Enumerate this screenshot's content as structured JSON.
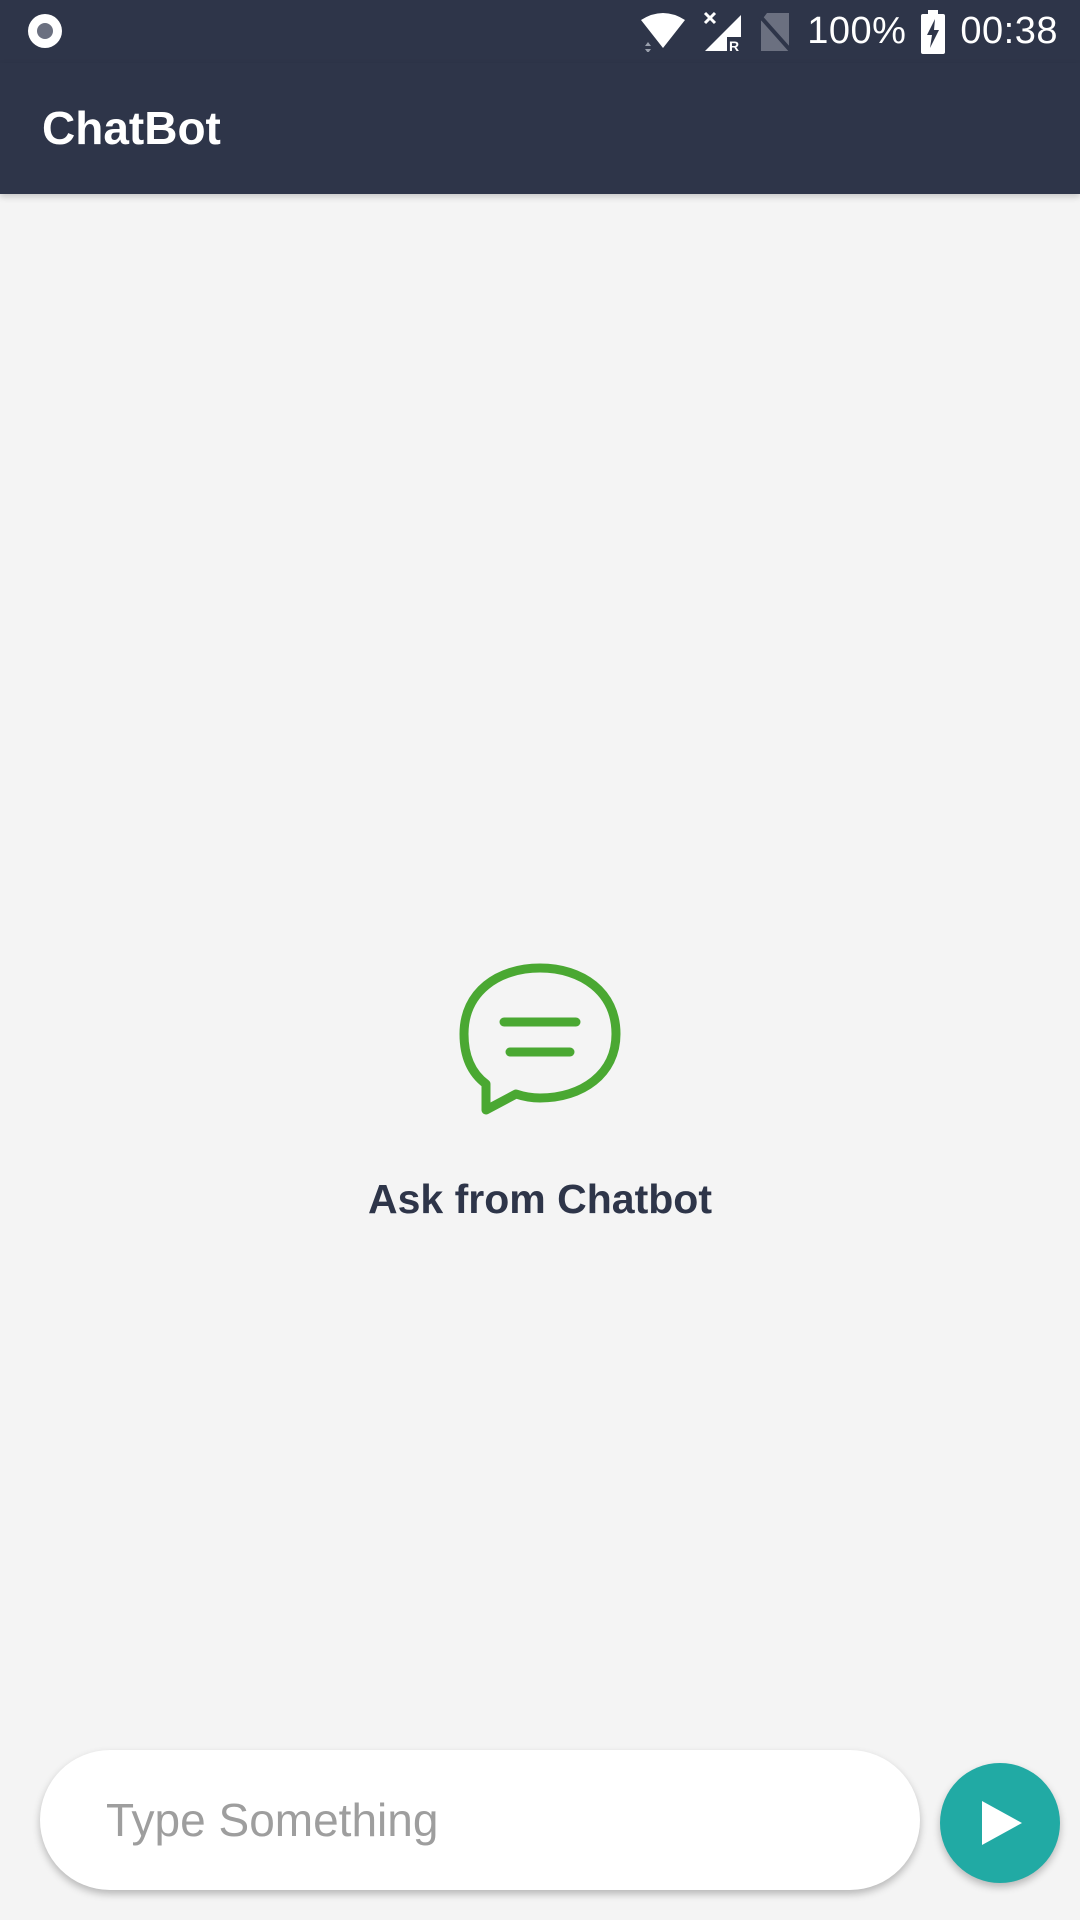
{
  "status_bar": {
    "battery": "100%",
    "time": "00:38",
    "icons": [
      "record-icon",
      "wifi-icon",
      "signal-icon",
      "no-sim-icon",
      "battery-charging-icon"
    ]
  },
  "app_bar": {
    "title": "ChatBot"
  },
  "empty_state": {
    "icon": "chat-bubble-icon",
    "label": "Ask from Chatbot"
  },
  "composer": {
    "placeholder": "Type Something",
    "value": "",
    "send_icon": "send-icon"
  },
  "colors": {
    "primary": "#2e3549",
    "accent": "#21aaa4",
    "icon_green": "#4aa832",
    "background": "#f4f4f4"
  }
}
